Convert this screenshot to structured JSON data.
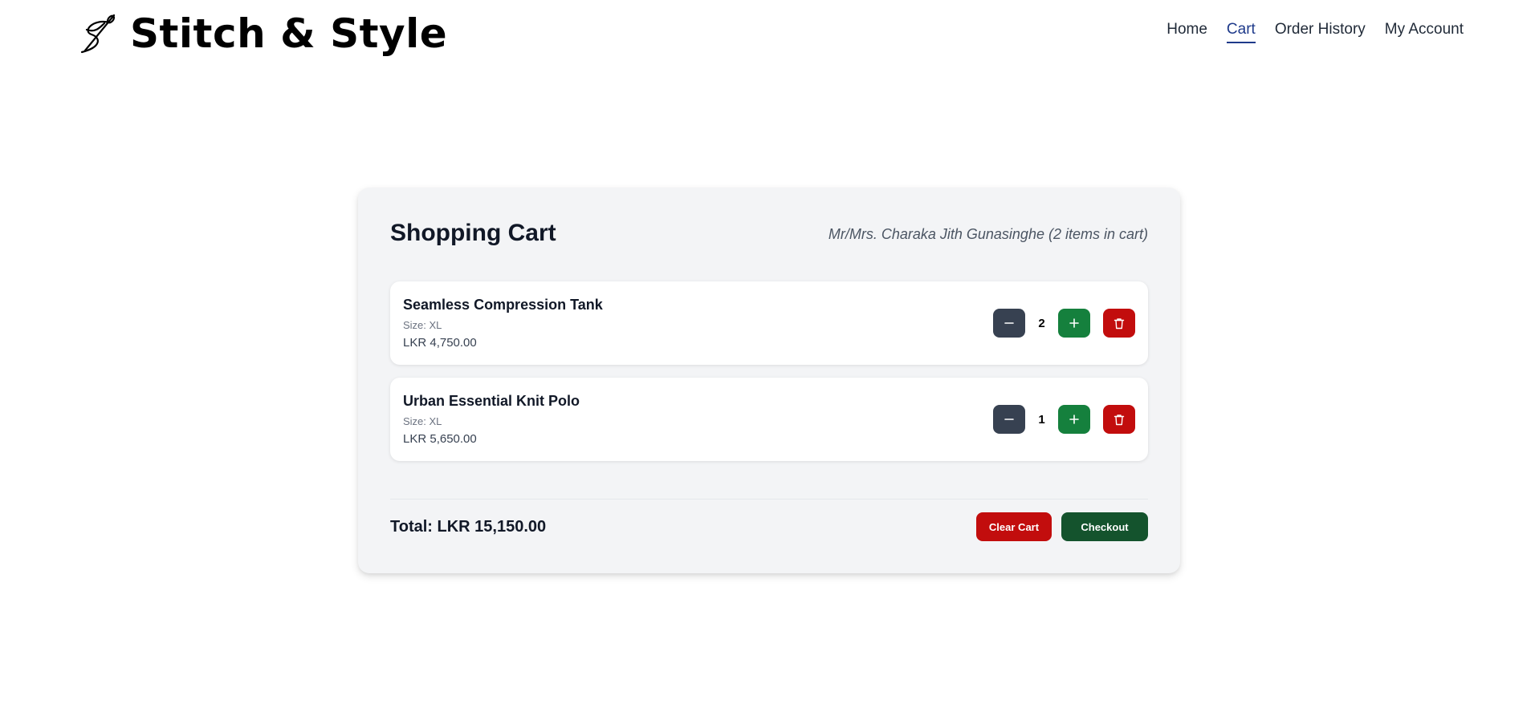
{
  "brand": {
    "name": "Stitch & Style",
    "icon": "needle-thread-icon"
  },
  "nav": {
    "items": [
      {
        "label": "Home",
        "active": false
      },
      {
        "label": "Cart",
        "active": true
      },
      {
        "label": "Order History",
        "active": false
      },
      {
        "label": "My Account",
        "active": false
      }
    ],
    "active_color": "#1e3a8a"
  },
  "cart": {
    "title": "Shopping Cart",
    "customer_line": "Mr/Mrs. Charaka Jith Gunasinghe (2 items in cart)",
    "items": [
      {
        "name": "Seamless Compression Tank",
        "size": "Size: XL",
        "price": "LKR 4,750.00",
        "quantity": "2"
      },
      {
        "name": "Urban Essential Knit Polo",
        "size": "Size: XL",
        "price": "LKR 5,650.00",
        "quantity": "1"
      }
    ],
    "total": "Total: LKR 15,150.00",
    "clear_label": "Clear Cart",
    "checkout_label": "Checkout"
  },
  "icons": {
    "minus": "minus-icon",
    "plus": "plus-icon",
    "delete": "trash-icon"
  },
  "colors": {
    "minus_btn": "#374151",
    "plus_btn": "#15803d",
    "delete_btn": "#c20d0d",
    "checkout_btn": "#14532d"
  }
}
